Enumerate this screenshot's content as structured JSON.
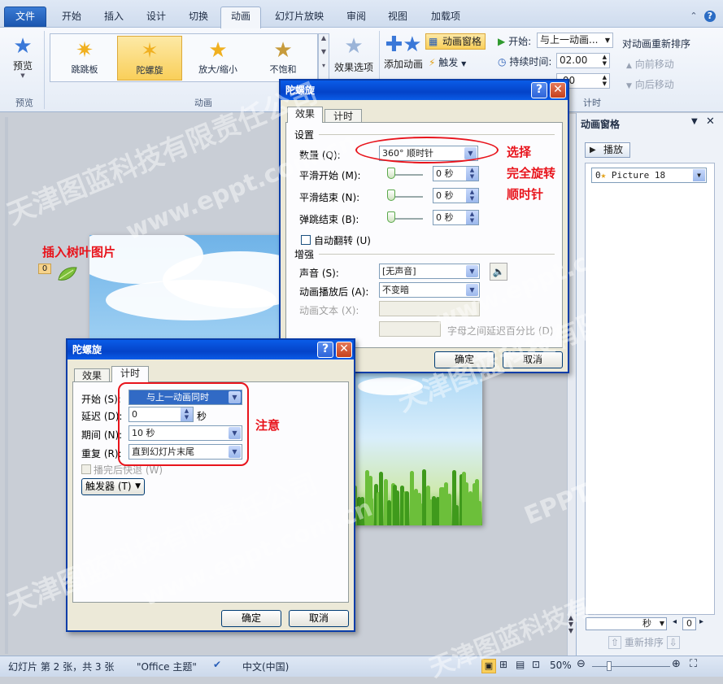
{
  "tabs": {
    "file": "文件",
    "items": [
      "开始",
      "插入",
      "设计",
      "切换",
      "动画",
      "幻灯片放映",
      "审阅",
      "视图",
      "加载项"
    ]
  },
  "ribbon": {
    "preview_label": "预览",
    "preview_group": "预览",
    "gallery": [
      {
        "label": "跳跳板"
      },
      {
        "label": "陀螺旋"
      },
      {
        "label": "放大/缩小"
      },
      {
        "label": "不饱和"
      }
    ],
    "effect_options": "效果选项",
    "animation_group": "动画",
    "add_animation": "添加动画",
    "anim_pane_btn": "动画窗格",
    "trigger": "触发",
    "start_label": "开始:",
    "start_value": "与上一动画...",
    "duration_label": "持续时间:",
    "duration_value": "02.00",
    "delay_value": ".00",
    "timing_group": "计时",
    "reorder_title": "对动画重新排序",
    "move_earlier": "向前移动",
    "move_later": "向后移动"
  },
  "pane": {
    "title": "动画窗格",
    "play": "播放",
    "item": "0",
    "item_name": "Picture 18",
    "seconds": "秒",
    "page": "0",
    "reorder": "重新排序"
  },
  "slide": {
    "insert_note": "插入树叶图片",
    "marker": "0"
  },
  "dialog_effect": {
    "title": "陀螺旋",
    "tab_effect": "效果",
    "tab_timing": "计时",
    "settings": "设置",
    "amount_label": "数量 (Q):",
    "amount_value": "360°  顺时针",
    "smooth_start_label": "平滑开始 (M):",
    "smooth_end_label": "平滑结束 (N):",
    "bounce_end_label": "弹跳结束 (B):",
    "smooth_start_value": "0 秒",
    "smooth_end_value": "0 秒",
    "bounce_end_value": "0 秒",
    "auto_reverse": "自动翻转 (U)",
    "enhance": "增强",
    "sound_label": "声音 (S):",
    "sound_value": "[无声音]",
    "after_label": "动画播放后 (A):",
    "after_value": "不变暗",
    "text_label": "动画文本 (X):",
    "delay_pct_label": "字母之间延迟百分比 (D)",
    "ok": "确定",
    "cancel": "取消",
    "note1": "选择",
    "note2": "完全旋转",
    "note3": "顺时针"
  },
  "dialog_timing": {
    "title": "陀螺旋",
    "tab_effect": "效果",
    "tab_timing": "计时",
    "start_label": "开始 (S):",
    "start_value": "与上一动画同时",
    "delay_label": "延迟 (D):",
    "delay_value": "0",
    "delay_unit": "秒",
    "period_label": "期间 (N):",
    "period_value": "10 秒",
    "repeat_label": "重复 (R):",
    "repeat_value": "直到幻灯片末尾",
    "rewind": "播完后快退 (W)",
    "trigger": "触发器 (T)",
    "ok": "确定",
    "cancel": "取消",
    "note": "注意"
  },
  "status": {
    "slide_info": "幻灯片 第 2 张，共 3 张",
    "theme": "\"Office 主题\"",
    "language": "中文(中国)",
    "zoom": "50%"
  },
  "watermarks": [
    "天津图蓝科技有限责任公司",
    "www.eppt.com.cn",
    "EPPT"
  ],
  "colors": {
    "annotation_red": "#e8141c",
    "title_blue": "#0a5ce8",
    "accent_gold": "#f9cf5a"
  }
}
